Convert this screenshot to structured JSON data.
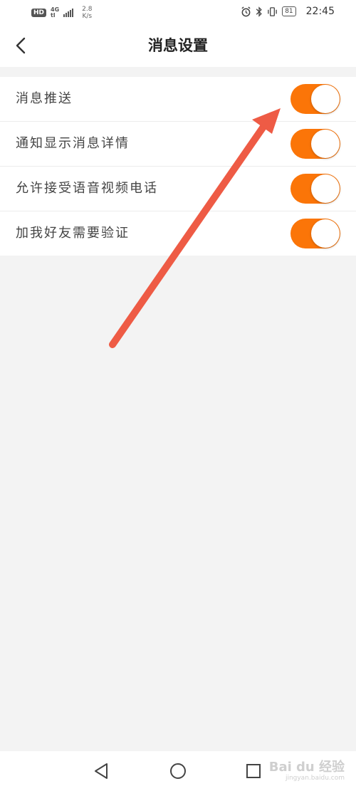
{
  "status_bar": {
    "hd_badge": "HD",
    "network_type_top": "4G",
    "network_type_bottom": "tl",
    "speed_value": "2.8",
    "speed_unit": "K/s",
    "battery": "81",
    "time": "22:45"
  },
  "header": {
    "title": "消息设置"
  },
  "settings": [
    {
      "label": "消息推送",
      "enabled": true
    },
    {
      "label": "通知显示消息详情",
      "enabled": true
    },
    {
      "label": "允许接受语音视频电话",
      "enabled": true
    },
    {
      "label": "加我好友需要验证",
      "enabled": true
    }
  ],
  "colors": {
    "toggle_on": "#fb7508",
    "annotation_arrow": "#ee5b45",
    "background": "#f3f3f3"
  },
  "watermark": {
    "logo": "Bai du 经验",
    "sub": "jingyan.baidu.com"
  }
}
